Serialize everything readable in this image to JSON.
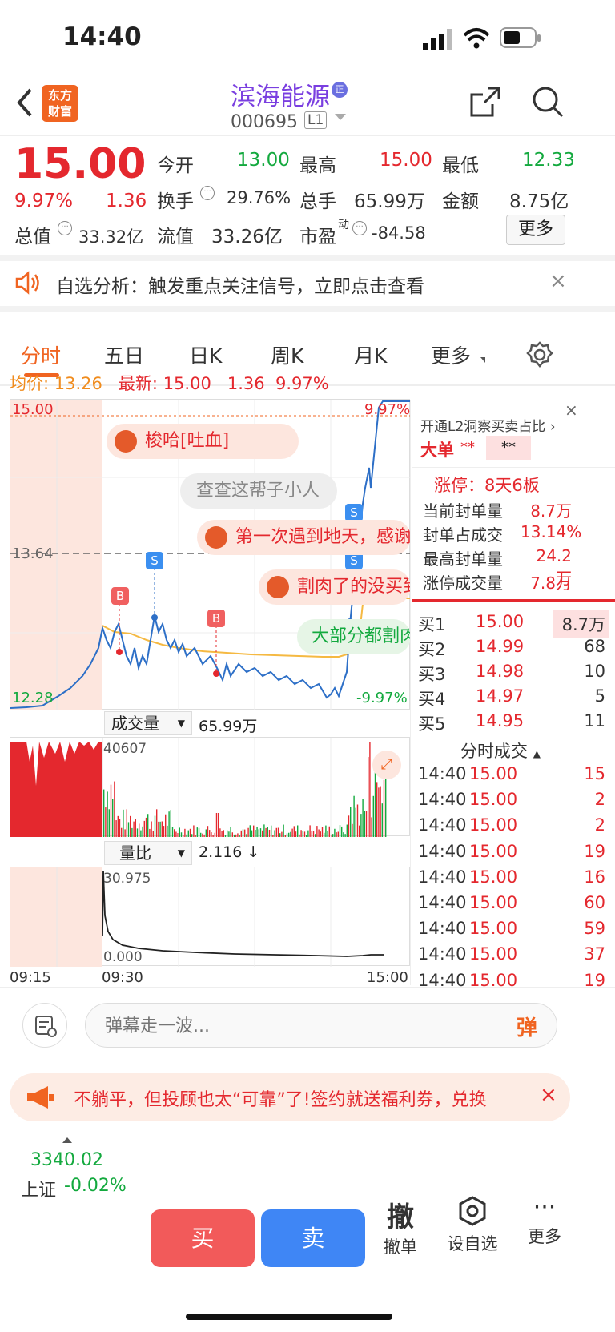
{
  "status_bar": {
    "time": "14:40"
  },
  "header": {
    "stock_name": "滨海能源",
    "stock_code": "000695",
    "level_badge": "L1",
    "logo_text_line1": "东方",
    "logo_text_line2": "财富"
  },
  "quote": {
    "price": "15.00",
    "change_pct": "9.97%",
    "change": "1.36",
    "open_label": "今开",
    "open": "13.00",
    "high_label": "最高",
    "high": "15.00",
    "low_label": "最低",
    "low": "12.33",
    "turnover_label": "换手",
    "turnover": "29.76%",
    "volume_label": "总手",
    "volume": "65.99万",
    "amount_label": "金额",
    "amount": "8.75亿",
    "mktcap_label": "总值",
    "mktcap": "33.32亿",
    "float_label": "流值",
    "float_cap": "33.26亿",
    "pe_label": "市盈",
    "pe_sup": "动",
    "pe": "-84.58",
    "more_button": "更多"
  },
  "notice": {
    "text": "自选分析：触发重点关注信号，立即点击查看"
  },
  "tabs": [
    "分时",
    "五日",
    "日K",
    "周K",
    "月K",
    "更多"
  ],
  "active_tab": "分时",
  "summary_line": {
    "avg_label": "均价:",
    "avg": "13.26",
    "latest_label": "最新:",
    "latest": "15.00",
    "change": "1.36",
    "pct": "9.97%"
  },
  "chart_labels": {
    "top_price": "15.00",
    "top_pct": "9.97%",
    "mid_price": "13.64",
    "low_price": "12.28",
    "low_pct": "-9.97%",
    "volume_title": "成交量",
    "volume_total": "65.99万",
    "volume_max": "40607",
    "ratio_title": "量比",
    "ratio_value": "2.116 ↓",
    "ratio_max": "30.975",
    "ratio_min": "0.000",
    "time_start": "09:15",
    "time_open": "09:30",
    "time_end": "15:00",
    "marker_b": "B",
    "marker_s": "S"
  },
  "danmaku": [
    "梭哈[吐血]",
    "查查这帮子小人",
    "第一次遇到地天，感谢",
    "割肉了的没买到",
    "大部分都割肉"
  ],
  "l2_panel": {
    "header": "开通L2洞察买卖占比",
    "big_order_label": "大单",
    "big_order_v1": "**",
    "big_order_v2": "**",
    "limit_up": "涨停：8天6板",
    "rows": [
      {
        "label": "当前封单量",
        "value": "8.7万"
      },
      {
        "label": "封单占成交",
        "value": "13.14%"
      },
      {
        "label": "最高封单量",
        "value": "24.2万"
      },
      {
        "label": "涨停成交量",
        "value": "7.8万"
      }
    ]
  },
  "order_book": [
    {
      "label": "买1",
      "price": "15.00",
      "qty": "8.7万"
    },
    {
      "label": "买2",
      "price": "14.99",
      "qty": "68"
    },
    {
      "label": "买3",
      "price": "14.98",
      "qty": "10"
    },
    {
      "label": "买4",
      "price": "14.97",
      "qty": "5"
    },
    {
      "label": "买5",
      "price": "14.95",
      "qty": "11"
    }
  ],
  "trades_title": "分时成交",
  "trades": [
    {
      "time": "14:40",
      "price": "15.00",
      "qty": "15"
    },
    {
      "time": "14:40",
      "price": "15.00",
      "qty": "2"
    },
    {
      "time": "14:40",
      "price": "15.00",
      "qty": "2"
    },
    {
      "time": "14:40",
      "price": "15.00",
      "qty": "19"
    },
    {
      "time": "14:40",
      "price": "15.00",
      "qty": "16"
    },
    {
      "time": "14:40",
      "price": "15.00",
      "qty": "60"
    },
    {
      "time": "14:40",
      "price": "15.00",
      "qty": "59"
    },
    {
      "time": "14:40",
      "price": "15.00",
      "qty": "37"
    },
    {
      "time": "14:40",
      "price": "15.00",
      "qty": "19"
    }
  ],
  "comment_bar": {
    "placeholder": "弹幕走一波...",
    "danmaku_button": "弹"
  },
  "promo": {
    "text": "不躺平，但投顾也太“可靠”了!签约就送福利券，兑换"
  },
  "bottom": {
    "index_value": "3340.02",
    "index_name": "上证",
    "index_change": "-0.02%",
    "buy": "买",
    "sell": "卖",
    "cancel_icon_text": "撤",
    "cancel": "撤单",
    "add_watch": "设自选",
    "more": "更多"
  },
  "colors": {
    "red": "#e4282e",
    "green": "#13a93e",
    "blue": "#2d6fc7",
    "avg": "#f5b942",
    "purple": "#7a3fe0"
  }
}
